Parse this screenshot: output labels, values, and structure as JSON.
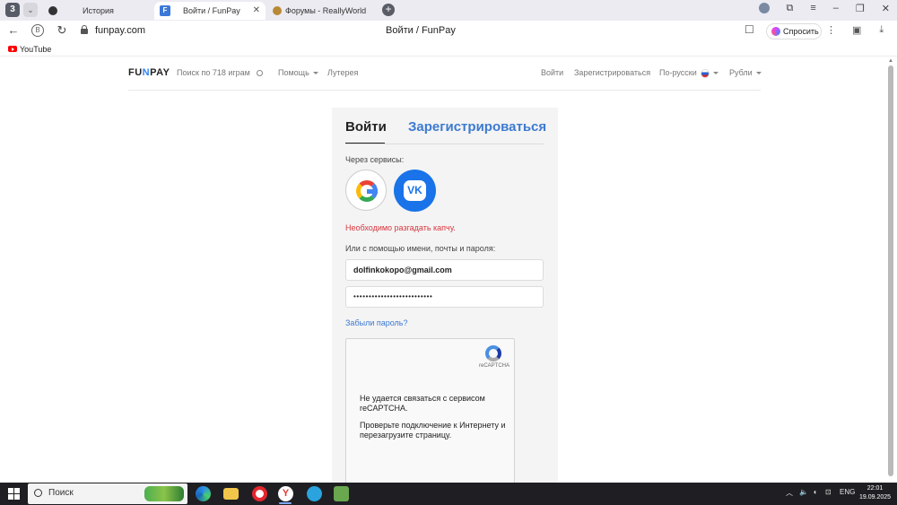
{
  "browser": {
    "tab_counter": "3",
    "tabs": [
      {
        "label": "История"
      },
      {
        "label": "Войти / FunPay"
      },
      {
        "label": "Форумы - ReallyWorld"
      }
    ],
    "url": "funpay.com",
    "page_title": "Войти / FunPay",
    "ask_button": "Спросить",
    "bookmarks": [
      {
        "label": "YouTube"
      }
    ]
  },
  "site_header": {
    "logo": {
      "left": "FU",
      "arrow": "N",
      "right": "PAY"
    },
    "search_placeholder": "Поиск по 718 играм",
    "help": "Помощь",
    "lottery": "Лутерея",
    "login": "Войти",
    "register": "Зарегистрироваться",
    "language": "По-русски",
    "currency": "Рубли"
  },
  "login_panel": {
    "tab_login": "Войти",
    "tab_register": "Зарегистрироваться",
    "services_label": "Через сервисы:",
    "google_letter": "G",
    "vk_letter": "VK",
    "error_message": "Необходимо разгадать капчу.",
    "credentials_label": "Или с помощью имени, почты и пароля:",
    "email_value": "dolfinkokopo@gmail.com",
    "password_value": "••••••••••••••••••••••••••",
    "forgot_link": "Забыли пароль?"
  },
  "recaptcha": {
    "brand": "reCAPTCHA",
    "message_1": "Не удается связаться с сервисом reCAPTCHA.",
    "message_2": "Проверьте подключение к Интернету и перезагрузите страницу."
  },
  "taskbar": {
    "search_label": "Поиск",
    "language": "ENG",
    "time": "22:01",
    "date": "19.09.2025",
    "apps": [
      {
        "name": "edge",
        "color": "#2b8ce8"
      },
      {
        "name": "file-explorer",
        "color": "#f2c64a"
      },
      {
        "name": "opera",
        "color": "#e3262f"
      },
      {
        "name": "yandex-browser",
        "color": "#ffffff"
      },
      {
        "name": "telegram",
        "color": "#2aa3df"
      },
      {
        "name": "minecraft",
        "color": "#6aa84f"
      }
    ]
  },
  "colors": {
    "accent_blue": "#3d7ad0",
    "error_red": "#d9363e",
    "vk_blue": "#1a73e8",
    "panel_bg": "#f4f4f4"
  }
}
